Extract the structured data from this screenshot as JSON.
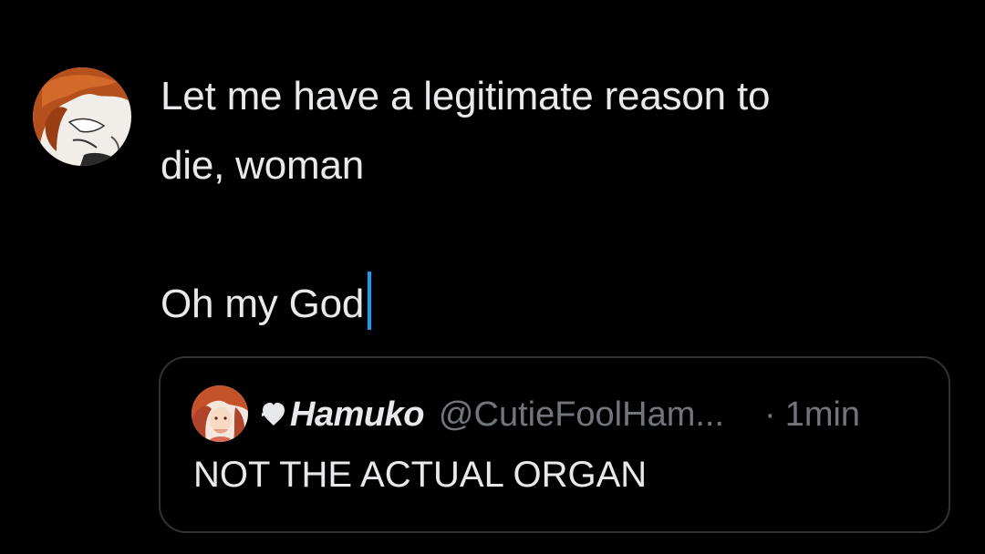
{
  "compose": {
    "line1": "Let me have a legitimate reason to",
    "line2": "die, woman",
    "line3": "Oh my God"
  },
  "quote": {
    "display_name": "Hamuko",
    "handle": "@CutieFoolHam...",
    "dot": "·",
    "time": "1min",
    "text": "NOT THE ACTUAL ORGAN"
  },
  "colors": {
    "background": "#000000",
    "text": "#e7e9ea",
    "secondary": "#71767b",
    "caret": "#1d9bf0",
    "border": "#2f3336"
  },
  "icons": {
    "user_avatar": "user-avatar",
    "quote_avatar": "quoted-user-avatar",
    "name_prefix": "heart-icon"
  }
}
